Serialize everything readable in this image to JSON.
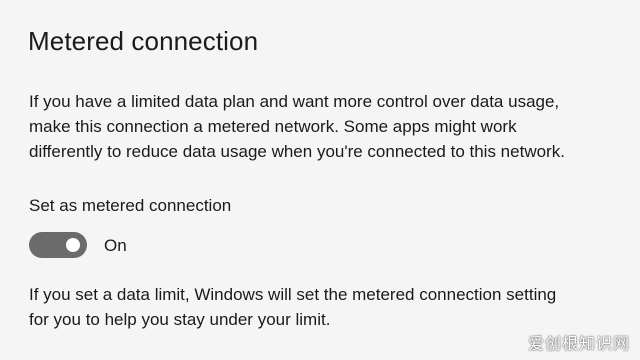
{
  "header": {
    "title": "Metered connection"
  },
  "description": {
    "lines": [
      "If you have a limited data plan and want more control over data usage,",
      "make this connection a metered network. Some apps might work",
      "differently to reduce data usage when you're connected to this network."
    ]
  },
  "metered_setting": {
    "label": "Set as metered connection",
    "toggle_on": true,
    "toggle_state_text": "On",
    "toggle_color": "#6b6b6b"
  },
  "note": {
    "lines": [
      "If you set a data limit, Windows will set the metered connection setting",
      "for you to help you stay under your limit."
    ]
  },
  "watermark": {
    "text": "爱创根知识网"
  },
  "colors": {
    "background": "#f5f5f5",
    "text": "#1a1a1a"
  }
}
